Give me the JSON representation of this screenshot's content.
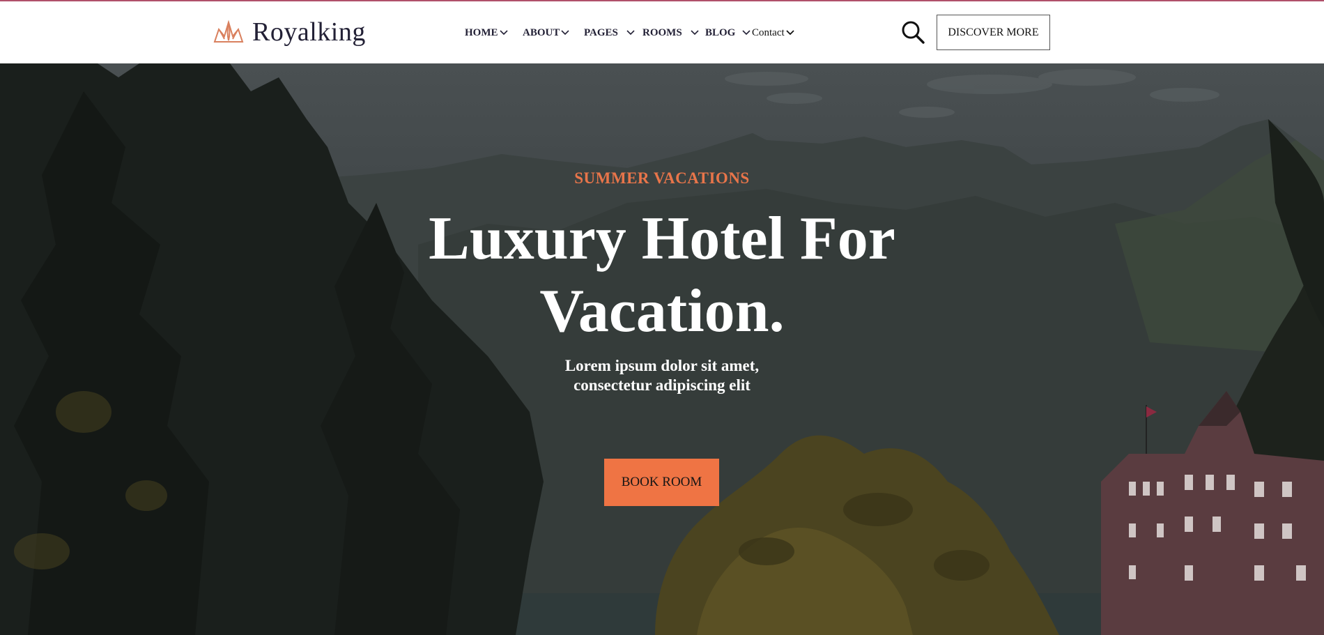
{
  "brand": {
    "name": "Royalking",
    "icon": "crown-icon",
    "accent": "#e8754a"
  },
  "nav": {
    "items": [
      {
        "label": "HOME",
        "dropdown": true
      },
      {
        "label": "ABOUT",
        "dropdown": true
      },
      {
        "label": "PAGES",
        "dropdown": true
      },
      {
        "label": "ROOMS",
        "dropdown": true
      },
      {
        "label": "BLOG",
        "dropdown": true
      },
      {
        "label": "Contact",
        "dropdown": true
      }
    ]
  },
  "header": {
    "search_icon": "search-icon",
    "discover_label": "DISCOVER MORE"
  },
  "hero": {
    "eyebrow": "SUMMER VACATIONS",
    "title_line1": "Luxury Hotel For",
    "title_line2": "Vacation.",
    "subtitle_line1": "Lorem ipsum dolor sit amet,",
    "subtitle_line2": "consectetur adipiscing elit",
    "cta_label": "BOOK ROOM",
    "cta_color": "#ef7444"
  }
}
